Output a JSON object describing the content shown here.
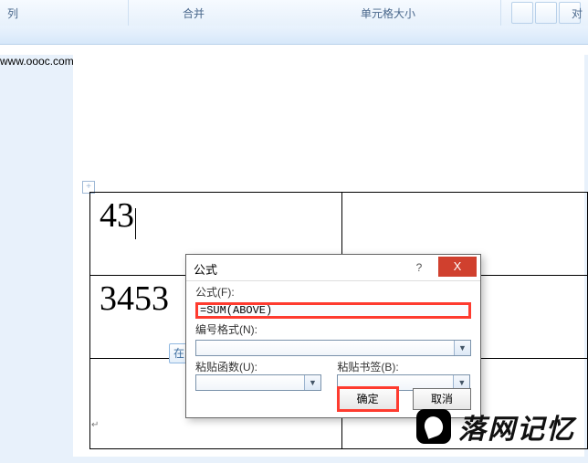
{
  "ribbon": {
    "col_label": "列",
    "merge_group": "合并",
    "cellsize_group": "单元格大小",
    "right_label": "对"
  },
  "table": {
    "r1c1": "43",
    "r2c1": "3453"
  },
  "corner_marker": "+",
  "float_fragment": "在",
  "dialog": {
    "title": "公式",
    "help": "?",
    "close": "X",
    "formula_label": "公式(F):",
    "formula_value": "=SUM(ABOVE)",
    "numfmt_label": "编号格式(N):",
    "numfmt_value": "",
    "pastefn_label": "粘贴函数(U):",
    "pastefn_value": "",
    "pastebm_label": "粘贴书签(B):",
    "pastebm_value": "",
    "ok": "确定",
    "cancel": "取消"
  },
  "brand": {
    "name": "落网记忆",
    "url": "www.oooc.com"
  }
}
